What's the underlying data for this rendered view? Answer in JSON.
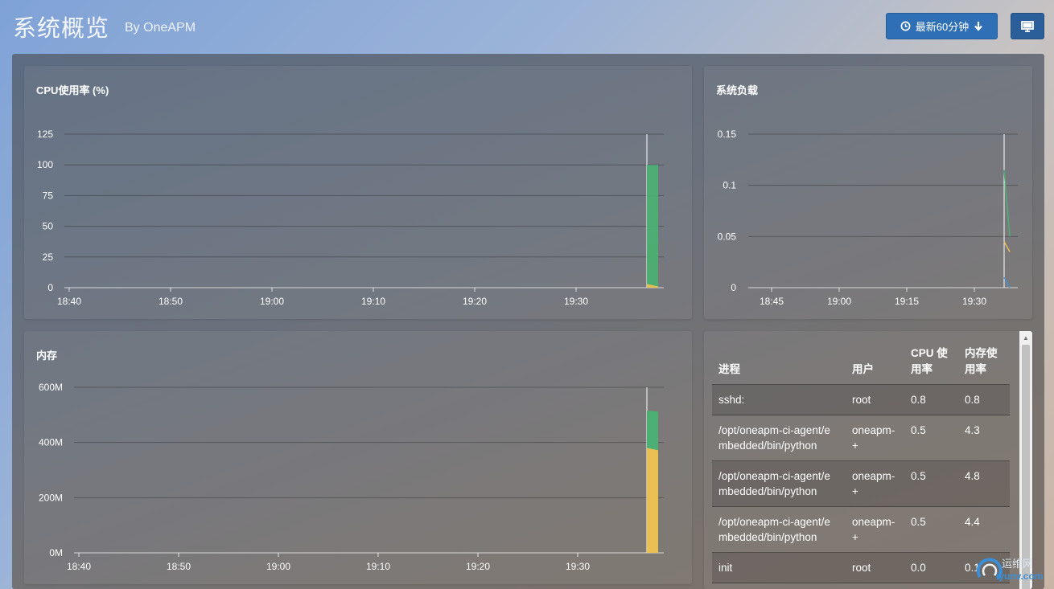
{
  "header": {
    "title": "系统概览",
    "subtitle": "By  OneAPM",
    "time_button_label": "最新60分钟"
  },
  "icons": {
    "time_icon": "clock-icon",
    "time_arrow": "arrow-down-icon",
    "screen_button": "monitor-icon"
  },
  "colors": {
    "green": "#4caf73",
    "yellow": "#e8c054",
    "blue": "#4a90d9",
    "primary_button": "#2f6fb5"
  },
  "panels": {
    "cpu": {
      "title": "CPU使用率 (%)",
      "chart_data": {
        "type": "area",
        "x": [
          "18:40",
          "18:50",
          "19:00",
          "19:10",
          "19:20",
          "19:30"
        ],
        "y_ticks": [
          "0",
          "25",
          "50",
          "75",
          "100",
          "125"
        ],
        "ylim": [
          0,
          125
        ],
        "grid": true,
        "series": [
          {
            "color": "#4caf73",
            "values_at_end": [
              100,
              100
            ]
          },
          {
            "color": "#e8c054",
            "values_at_end": [
              3,
              1
            ]
          }
        ]
      }
    },
    "load": {
      "title": "系统负载",
      "chart_data": {
        "type": "line",
        "x": [
          "18:45",
          "19:00",
          "19:15",
          "19:30"
        ],
        "y_ticks": [
          "0",
          "0.05",
          "0.1",
          "0.15"
        ],
        "ylim": [
          0,
          0.15
        ],
        "grid": true,
        "series": [
          {
            "color": "#4caf73",
            "values_at_end": [
              0.115,
              0.05
            ]
          },
          {
            "color": "#e8c054",
            "values_at_end": [
              0.045,
              0.035
            ]
          },
          {
            "color": "#4a90d9",
            "values_at_end": [
              0.01,
              0.0
            ]
          }
        ]
      }
    },
    "memory": {
      "title": "内存",
      "chart_data": {
        "type": "area",
        "x": [
          "18:40",
          "18:50",
          "19:00",
          "19:10",
          "19:20",
          "19:30"
        ],
        "y_ticks": [
          "0M",
          "200M",
          "400M",
          "600M"
        ],
        "ylim": [
          0,
          600
        ],
        "grid": true,
        "series": [
          {
            "color": "#e8c054",
            "values_at_end": [
              380,
              372
            ]
          },
          {
            "color": "#4caf73",
            "values_at_end": [
              515,
              512
            ]
          }
        ]
      }
    }
  },
  "process_table": {
    "headers": [
      "进程",
      "用户",
      "CPU 使用率",
      "内存使用率"
    ],
    "rows": [
      [
        "sshd:",
        "root",
        "0.8",
        "0.8"
      ],
      [
        "/opt/oneapm-ci-agent/embedded/bin/python",
        "oneapm-+",
        "0.5",
        "4.3"
      ],
      [
        "/opt/oneapm-ci-agent/embedded/bin/python",
        "oneapm-+",
        "0.5",
        "4.8"
      ],
      [
        "/opt/oneapm-ci-agent/embedded/bin/python",
        "oneapm-+",
        "0.5",
        "4.4"
      ],
      [
        "init",
        "root",
        "0.0",
        "0.1"
      ]
    ]
  },
  "watermark": {
    "text_cn": "运维网",
    "text_en": "iyunv.com"
  }
}
